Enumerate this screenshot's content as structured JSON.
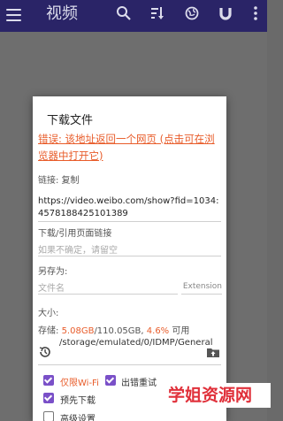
{
  "appbar": {
    "title": "视频",
    "icons": [
      "menu-icon",
      "search-icon",
      "sort-icon",
      "globe-icon",
      "magnet-icon",
      "more-vertical-icon"
    ],
    "color": "#2a2467"
  },
  "dialog": {
    "title": "下载文件",
    "error_link": "错误: 该地址返回一个网页 (点击可在浏览器中打开它)",
    "link_label": "链接: 复制",
    "url": "https://video.weibo.com/show?fid=1034:4578188425101389",
    "referer_label": "下载/引用页面链接",
    "referer_placeholder": "如果不确定，请留空",
    "save_as_label": "另存为:",
    "filename_placeholder": "文件名",
    "extension_label": "Extension",
    "size_label": "大小:",
    "storage_prefix": "存储:",
    "storage_free": "5.08GB",
    "storage_total": "/110.05GB,",
    "storage_percent": "4.6%",
    "storage_suffix": "可用",
    "path": "/storage/emulated/0/IDMP/General",
    "checkboxes": {
      "wifi_only": {
        "label": "仅限Wi-Fi",
        "checked": true
      },
      "retry_on_error": {
        "label": "出错重试",
        "checked": true
      },
      "pre_download": {
        "label": "预先下载",
        "checked": true
      },
      "advanced": {
        "label": "高级设置",
        "checked": false
      }
    }
  },
  "watermark": "学姐资源网",
  "colors": {
    "accent": "#7a50c8",
    "error": "#e85c2a",
    "watermark": "#e0303a"
  }
}
